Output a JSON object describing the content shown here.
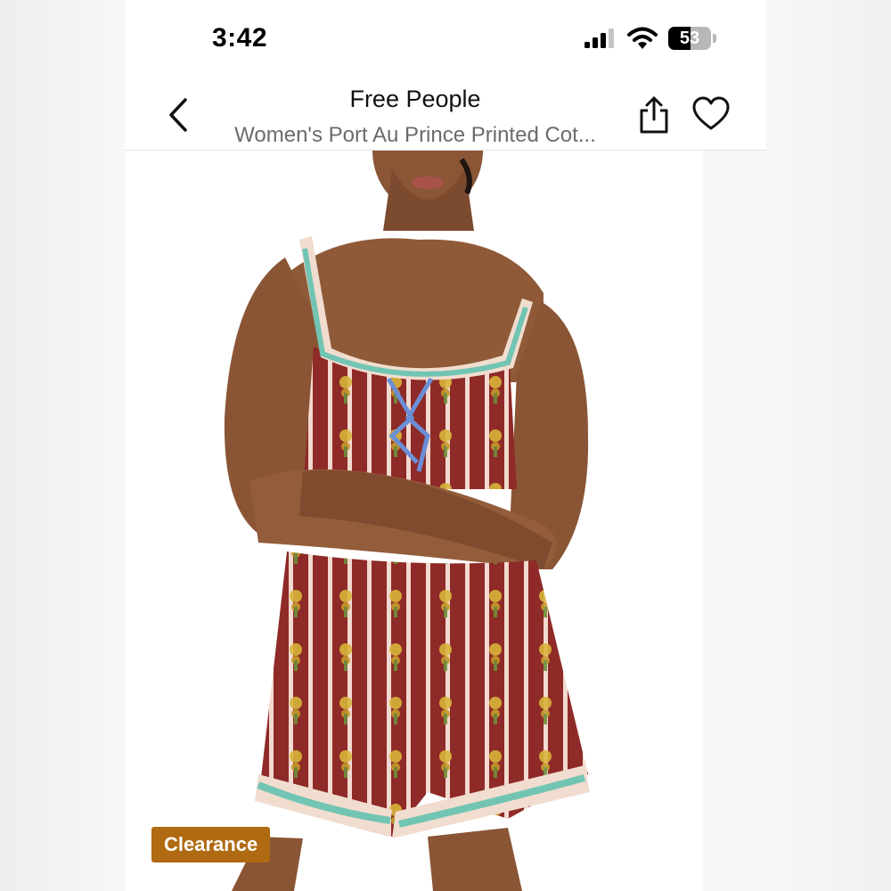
{
  "status_bar": {
    "time": "3:42",
    "battery_level": "53",
    "battery_fraction": 0.53
  },
  "header": {
    "brand": "Free People",
    "product_title": "Women's Port Au Prince Printed Cot..."
  },
  "icons": {
    "back": "chevron-left-icon",
    "share": "share-icon",
    "favorite": "heart-icon",
    "signal": "cellular-signal-icon",
    "wifi": "wifi-icon",
    "battery": "battery-icon"
  },
  "badge": {
    "label": "Clearance",
    "color": "#b06a12"
  },
  "colors": {
    "garment_base": "#8e2a27",
    "garment_stripe": "#f3d9cf",
    "motif": "#d8b43a",
    "trim_teal": "#5cbfae"
  }
}
